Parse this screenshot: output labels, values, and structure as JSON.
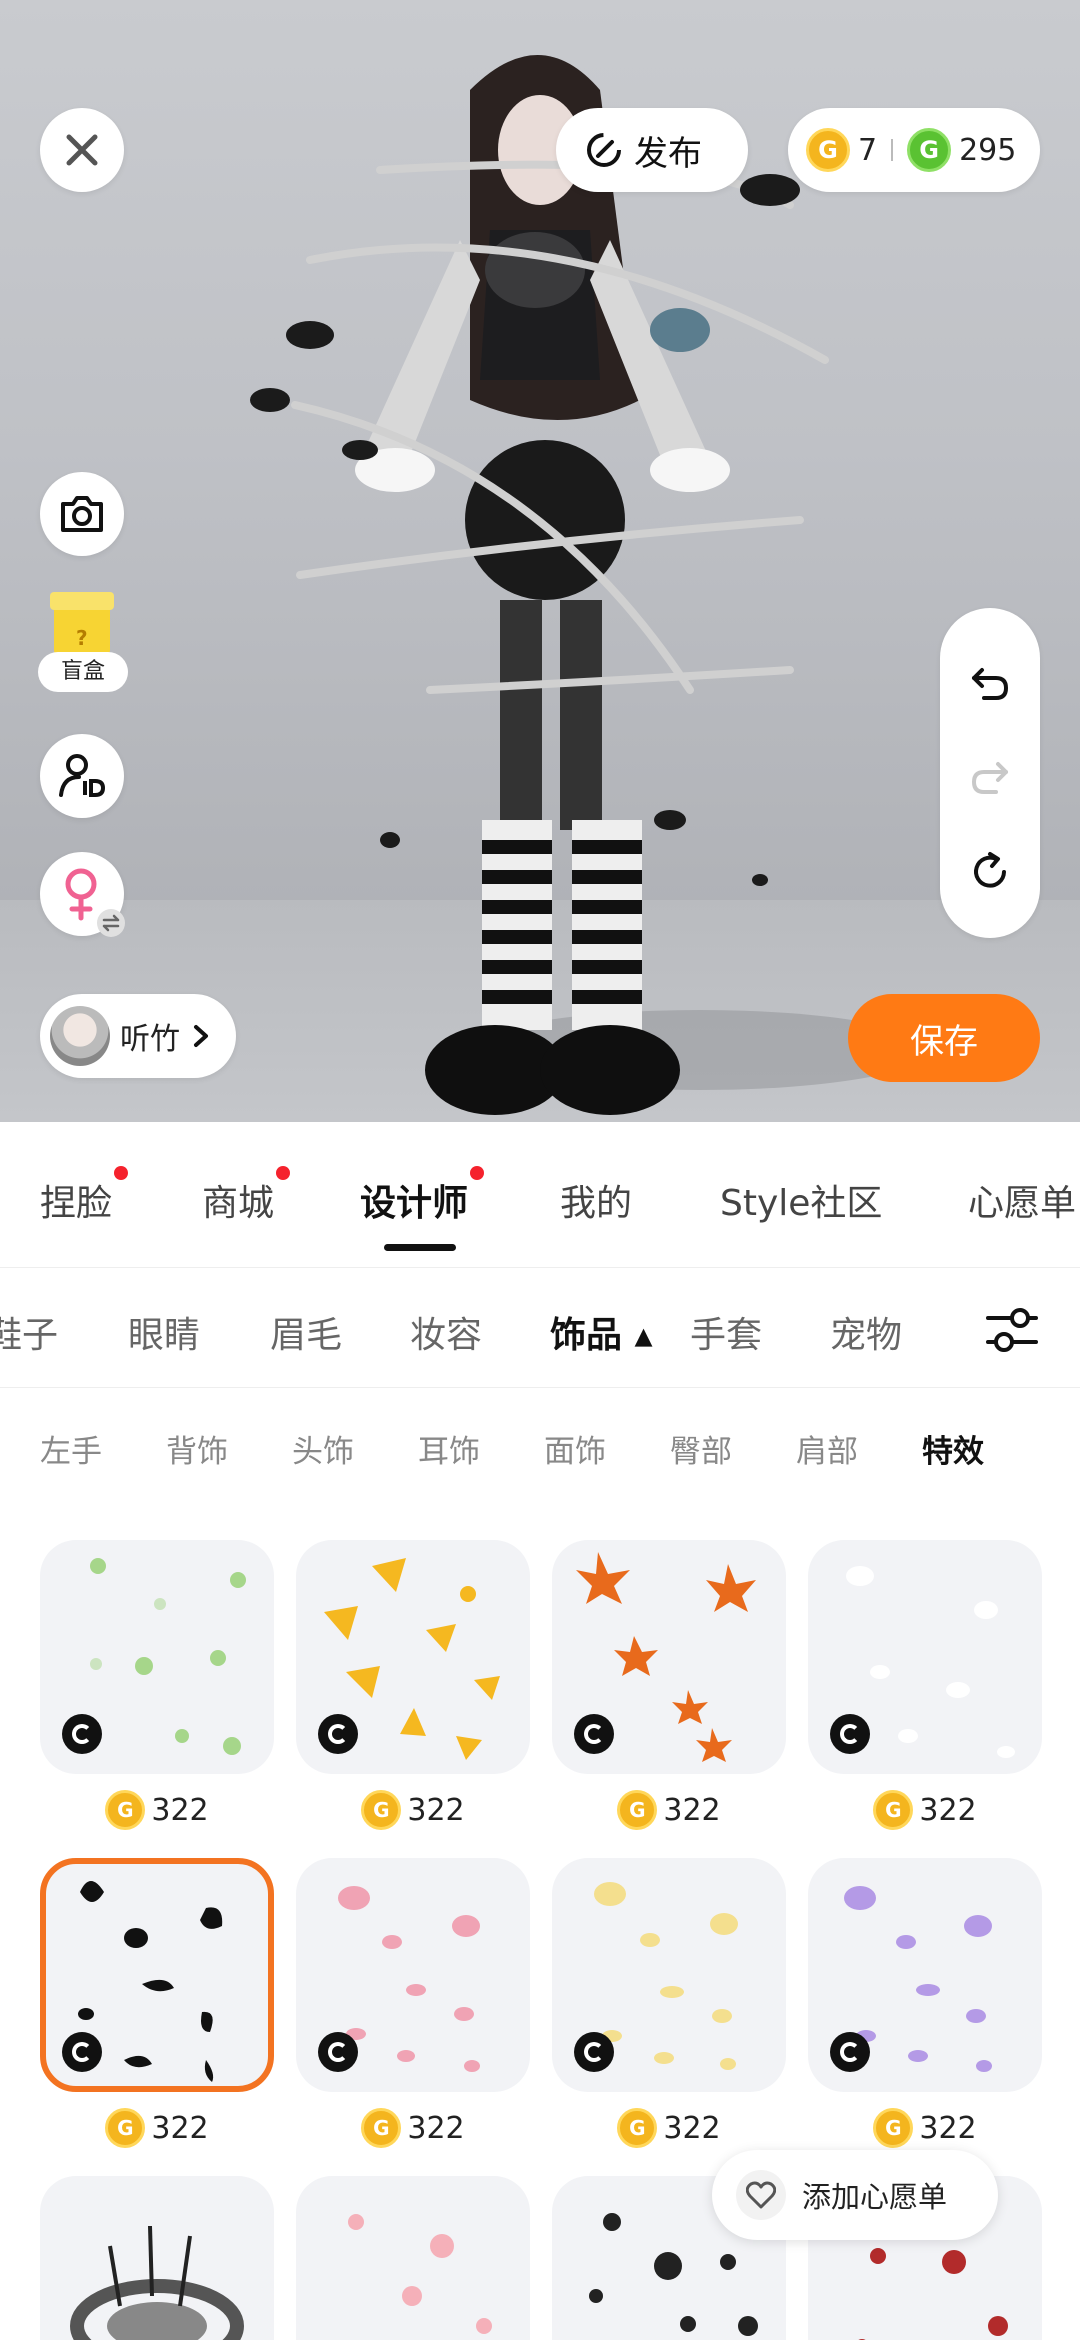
{
  "top_bar": {
    "publish_label": "发布",
    "gold_coins": "7",
    "green_coins": "295",
    "gold_coin_symbol": "G",
    "green_coin_symbol": "G"
  },
  "left_tools": {
    "blind_box_label": "盲盒"
  },
  "user_chip": {
    "name": "听竹"
  },
  "save_label": "保存",
  "main_tabs": [
    {
      "label": "捏脸",
      "has_dot": true
    },
    {
      "label": "商城",
      "has_dot": true
    },
    {
      "label": "设计师",
      "has_dot": true,
      "active": true
    },
    {
      "label": "我的"
    },
    {
      "label": "Style社区"
    },
    {
      "label": "心愿单"
    }
  ],
  "category_tabs": [
    {
      "label": "鞋子"
    },
    {
      "label": "眼睛"
    },
    {
      "label": "眉毛"
    },
    {
      "label": "妆容"
    },
    {
      "label": "饰品 ▴",
      "active": true
    },
    {
      "label": "手套"
    },
    {
      "label": "宠物"
    }
  ],
  "sub_tabs": [
    {
      "label": "左手"
    },
    {
      "label": "背饰"
    },
    {
      "label": "头饰"
    },
    {
      "label": "耳饰"
    },
    {
      "label": "面饰"
    },
    {
      "label": "臀部"
    },
    {
      "label": "肩部"
    },
    {
      "label": "特效",
      "active": true
    }
  ],
  "items": [
    {
      "name": "clover",
      "price": "322",
      "color": "#a6d68a"
    },
    {
      "name": "ginkgo",
      "price": "322",
      "color": "#f5b820"
    },
    {
      "name": "maple",
      "price": "322",
      "color": "#e86a1c"
    },
    {
      "name": "white-petals",
      "price": "322",
      "color": "#ffffff"
    },
    {
      "name": "black-petals",
      "price": "322",
      "color": "#111111",
      "selected": true
    },
    {
      "name": "pink-petals",
      "price": "322",
      "color": "#f0a3b4"
    },
    {
      "name": "yellow-petals",
      "price": "322",
      "color": "#f4df8e"
    },
    {
      "name": "purple-petals",
      "price": "322",
      "color": "#b49ae6"
    },
    {
      "name": "dark-halo",
      "price": "",
      "color": "#555555"
    },
    {
      "name": "pink-swirl",
      "price": "",
      "color": "#f5b0b9"
    },
    {
      "name": "black-swirl",
      "price": "",
      "color": "#222222"
    },
    {
      "name": "red-swirl",
      "price": "",
      "color": "#b22b2b"
    }
  ],
  "wishlist_label": "添加心愿单"
}
